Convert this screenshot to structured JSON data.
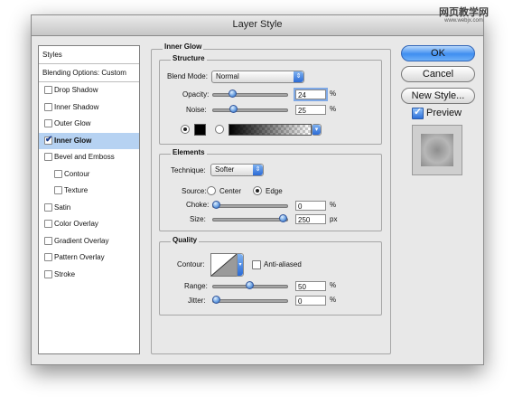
{
  "window": {
    "title": "Layer Style"
  },
  "watermark": {
    "line1": "网页教学网",
    "line2": "www.webjx.com"
  },
  "style_list": {
    "header": "Styles",
    "blending": "Blending Options: Custom",
    "items": [
      {
        "label": "Drop Shadow",
        "checked": false,
        "indent": false
      },
      {
        "label": "Inner Shadow",
        "checked": false,
        "indent": false
      },
      {
        "label": "Outer Glow",
        "checked": false,
        "indent": false
      },
      {
        "label": "Inner Glow",
        "checked": true,
        "indent": false,
        "selected": true
      },
      {
        "label": "Bevel and Emboss",
        "checked": false,
        "indent": false
      },
      {
        "label": "Contour",
        "checked": false,
        "indent": true
      },
      {
        "label": "Texture",
        "checked": false,
        "indent": true
      },
      {
        "label": "Satin",
        "checked": false,
        "indent": false
      },
      {
        "label": "Color Overlay",
        "checked": false,
        "indent": false
      },
      {
        "label": "Gradient Overlay",
        "checked": false,
        "indent": false
      },
      {
        "label": "Pattern Overlay",
        "checked": false,
        "indent": false
      },
      {
        "label": "Stroke",
        "checked": false,
        "indent": false
      }
    ]
  },
  "inner_glow": {
    "title": "Inner Glow",
    "structure": {
      "title": "Structure",
      "blend_mode_label": "Blend Mode:",
      "blend_mode_value": "Normal",
      "opacity_label": "Opacity:",
      "opacity_value": "24",
      "opacity_unit": "%",
      "opacity_fraction": 0.24,
      "noise_label": "Noise:",
      "noise_value": "25",
      "noise_unit": "%",
      "noise_fraction": 0.25,
      "color_mode": "solid",
      "color": "#000000"
    },
    "elements": {
      "title": "Elements",
      "technique_label": "Technique:",
      "technique_value": "Softer",
      "source_label": "Source:",
      "source_center": "Center",
      "source_edge": "Edge",
      "source_selected": "Edge",
      "choke_label": "Choke:",
      "choke_value": "0",
      "choke_unit": "%",
      "choke_fraction": 0,
      "size_label": "Size:",
      "size_value": "250",
      "size_unit": "px",
      "size_fraction": 1.0
    },
    "quality": {
      "title": "Quality",
      "contour_label": "Contour:",
      "antialiased_label": "Anti-aliased",
      "antialiased_checked": false,
      "range_label": "Range:",
      "range_value": "50",
      "range_unit": "%",
      "range_fraction": 0.5,
      "jitter_label": "Jitter:",
      "jitter_value": "0",
      "jitter_unit": "%",
      "jitter_fraction": 0
    }
  },
  "buttons": {
    "ok": "OK",
    "cancel": "Cancel",
    "new_style": "New Style..."
  },
  "preview": {
    "label": "Preview",
    "checked": true
  },
  "colors": {
    "accent": "#3f8ef0",
    "selection": "#b6d2f2",
    "window_bg": "#e8e8e8"
  }
}
